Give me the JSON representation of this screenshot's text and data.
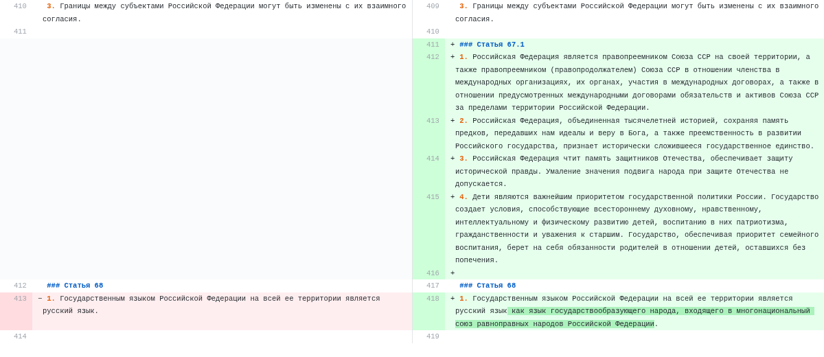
{
  "rows": [
    {
      "left": {
        "kind": "context",
        "number": "410",
        "segments": [
          {
            "kind": "num",
            "text": "3."
          },
          {
            "kind": "text",
            "text": " Границы между субъектами Российской Федерации могут быть изменены с их взаимного согласия."
          }
        ]
      },
      "right": {
        "kind": "context",
        "number": "409",
        "segments": [
          {
            "kind": "num",
            "text": "3."
          },
          {
            "kind": "text",
            "text": " Границы между субъектами Российской Федерации могут быть изменены с их взаимного согласия."
          }
        ]
      }
    },
    {
      "left": {
        "kind": "context",
        "number": "411"
      },
      "right": {
        "kind": "context",
        "number": "410"
      }
    },
    {
      "left": {
        "kind": "empty"
      },
      "right": {
        "kind": "added",
        "number": "411",
        "sign": "+",
        "segments": [
          {
            "kind": "heading",
            "text": "### Статья 67.1"
          }
        ]
      }
    },
    {
      "left": {
        "kind": "empty"
      },
      "right": {
        "kind": "added",
        "number": "412",
        "sign": "+",
        "segments": [
          {
            "kind": "num",
            "text": "1."
          },
          {
            "kind": "text",
            "text": " Российская Федерация является правопреемником Союза ССР на своей территории, а также правопреемником (правопродолжателем) Союза ССР в отношении членства в международных организациях, их органах, участия в международных договорах, а также в отношении предусмотренных международными договорами обязательств и активов Союза ССР за пределами территории Российской Федерации."
          }
        ]
      }
    },
    {
      "left": {
        "kind": "empty"
      },
      "right": {
        "kind": "added",
        "number": "413",
        "sign": "+",
        "segments": [
          {
            "kind": "num",
            "text": "2."
          },
          {
            "kind": "text",
            "text": " Российская Федерация, объединенная тысячелетней историей, сохраняя память предков, передавших нам идеалы и веру в Бога, а также преемственность в развитии Российского государства, признает исторически сложившееся государственное единство."
          }
        ]
      }
    },
    {
      "left": {
        "kind": "empty"
      },
      "right": {
        "kind": "added",
        "number": "414",
        "sign": "+",
        "segments": [
          {
            "kind": "num",
            "text": "3."
          },
          {
            "kind": "text",
            "text": " Российская Федерация чтит память защитников Отечества, обеспечивает защиту исторической правды. Умаление значения подвига народа при защите Отечества не допускается."
          }
        ]
      }
    },
    {
      "left": {
        "kind": "empty"
      },
      "right": {
        "kind": "added",
        "number": "415",
        "sign": "+",
        "segments": [
          {
            "kind": "num",
            "text": "4."
          },
          {
            "kind": "text",
            "text": " Дети являются важнейшим приоритетом государственной политики России. Государство создает условия, способствующие всестороннему духовному, нравственному, интеллектуальному и физическому развитию детей, воспитанию в них патриотизма, гражданственности и уважения к старшим. Государство, обеспечивая приоритет семейного воспитания, берет на себя обязанности родителей в отношении детей, оставшихся без попечения."
          }
        ]
      }
    },
    {
      "left": {
        "kind": "empty"
      },
      "right": {
        "kind": "added",
        "number": "416",
        "sign": "+"
      }
    },
    {
      "left": {
        "kind": "context",
        "number": "412",
        "segments": [
          {
            "kind": "heading",
            "text": "### Статья 68"
          }
        ]
      },
      "right": {
        "kind": "context",
        "number": "417",
        "segments": [
          {
            "kind": "heading",
            "text": "### Статья 68"
          }
        ]
      }
    },
    {
      "left": {
        "kind": "removed",
        "number": "413",
        "sign": "−",
        "segments": [
          {
            "kind": "num",
            "text": "1."
          },
          {
            "kind": "text",
            "text": " Государственным языком Российской Федерации на всей ее территории является русский язык."
          }
        ]
      },
      "right": {
        "kind": "added",
        "number": "418",
        "sign": "+",
        "segments": [
          {
            "kind": "num",
            "text": "1."
          },
          {
            "kind": "text",
            "text": " Государственным языком Российской Федерации на всей ее территории является русский язык"
          },
          {
            "kind": "inserted",
            "text": " как язык государствообразующего народа, входящего в многонациональный союз равноправных народов Российской Федерации"
          },
          {
            "kind": "text",
            "text": "."
          }
        ]
      }
    },
    {
      "left": {
        "kind": "context",
        "number": "414"
      },
      "right": {
        "kind": "context",
        "number": "419"
      }
    }
  ]
}
